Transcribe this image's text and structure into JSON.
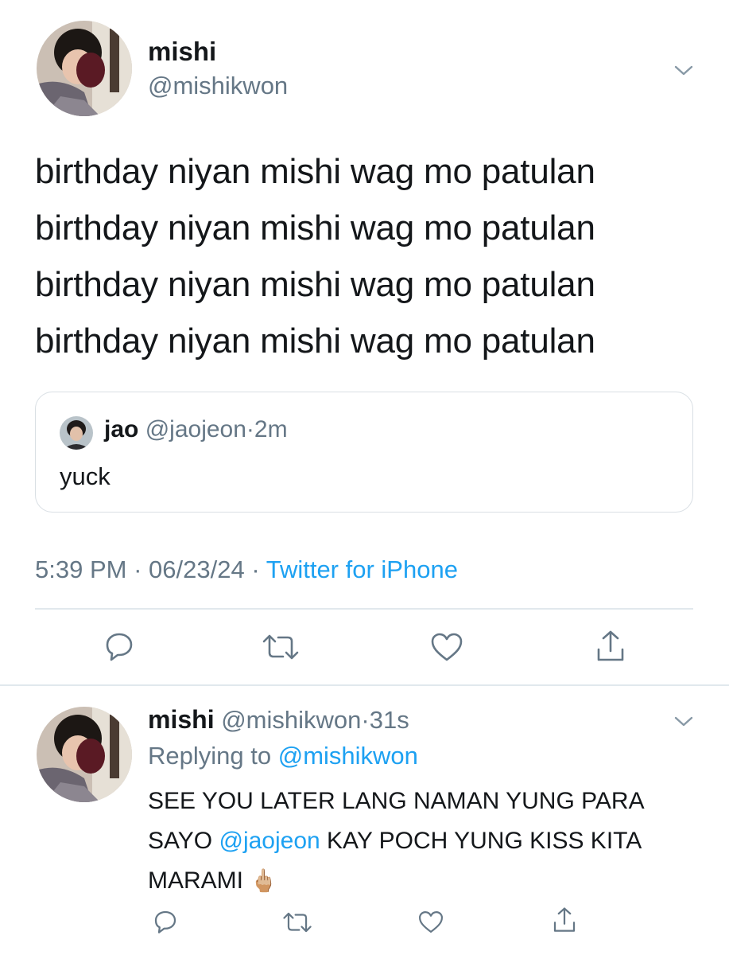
{
  "main_tweet": {
    "author_name": "mishi",
    "author_handle": "@mishikwon",
    "text_lines": [
      "birthday niyan mishi wag mo patulan",
      "birthday niyan mishi wag mo patulan",
      "birthday niyan mishi wag mo patulan",
      "birthday niyan mishi wag mo patulan"
    ],
    "quoted": {
      "author_name": "jao",
      "author_handle": "@jaojeon",
      "separator": "·",
      "time": "2m",
      "text": "yuck"
    },
    "time": "5:39 PM",
    "sep1": "·",
    "date": "06/23/24",
    "sep2": "·",
    "source": "Twitter for iPhone"
  },
  "reply_tweet": {
    "author_name": "mishi",
    "author_handle": "@mishikwon",
    "separator": "·",
    "time": "31s",
    "replying_prefix": "Replying to",
    "replying_to": "@mishikwon",
    "text_part1": "SEE YOU LATER LANG NAMAN YUNG PARA SAYO ",
    "mention": "@jaojeon",
    "text_part2": " KAY POCH YUNG KISS KITA MARAMI ",
    "emoji": "🖕🏼"
  },
  "icons": {
    "reply": "reply-icon",
    "retweet": "retweet-icon",
    "like": "like-icon",
    "share": "share-icon",
    "more": "chevron-down-icon"
  },
  "colors": {
    "text": "#14171a",
    "muted": "#657786",
    "link": "#1da1f2",
    "border": "#e1e8ed"
  }
}
